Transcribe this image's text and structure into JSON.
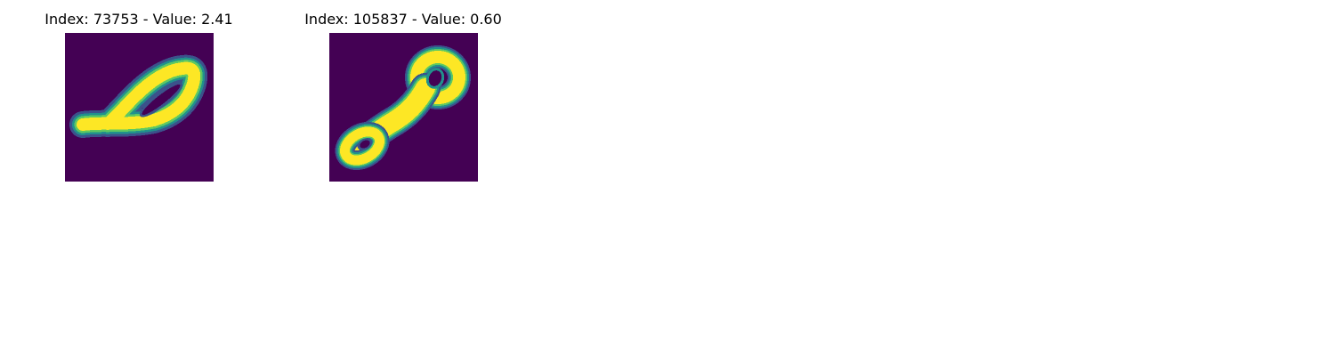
{
  "panels": [
    {
      "title": "Index: 73753 - Value: 2.41"
    },
    {
      "title": "Index: 105837 - Value: 0.60"
    }
  ],
  "colors": {
    "background_dark": "#440154",
    "foreground_bright": "#fde725",
    "edge_green": "#5ec962",
    "edge_teal": "#21918c",
    "edge_blue": "#3b528b"
  },
  "colormap": "viridis"
}
